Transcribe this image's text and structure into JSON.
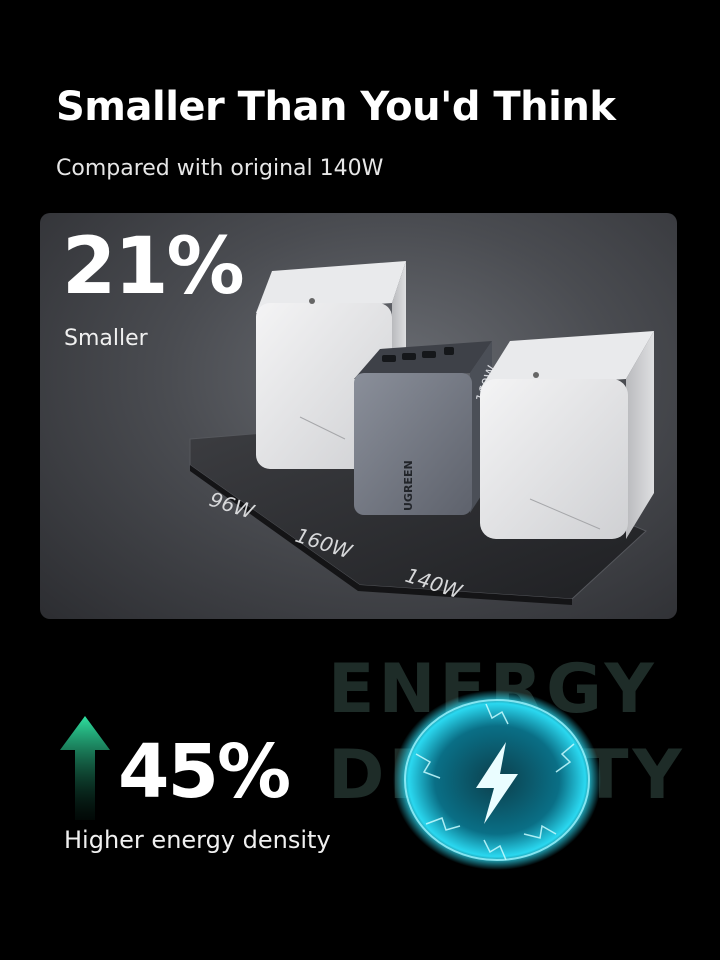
{
  "headline": "Smaller Than You'd Think",
  "subline": "Compared with original 140W",
  "comparison": {
    "percent": "21%",
    "caption": "Smaller",
    "chargers": [
      {
        "label": "96W"
      },
      {
        "label": "160W"
      },
      {
        "label": "140W"
      }
    ],
    "brand": "UGREEN",
    "product_mark": "160W"
  },
  "energy": {
    "background_word_1": "ENERGY",
    "background_word_2": "DENSITY",
    "percent": "45%",
    "caption": "Higher energy density"
  },
  "colors": {
    "background": "#000000",
    "accent_green": "#2fe0a0",
    "orb_cyan": "#2ad8f0"
  }
}
